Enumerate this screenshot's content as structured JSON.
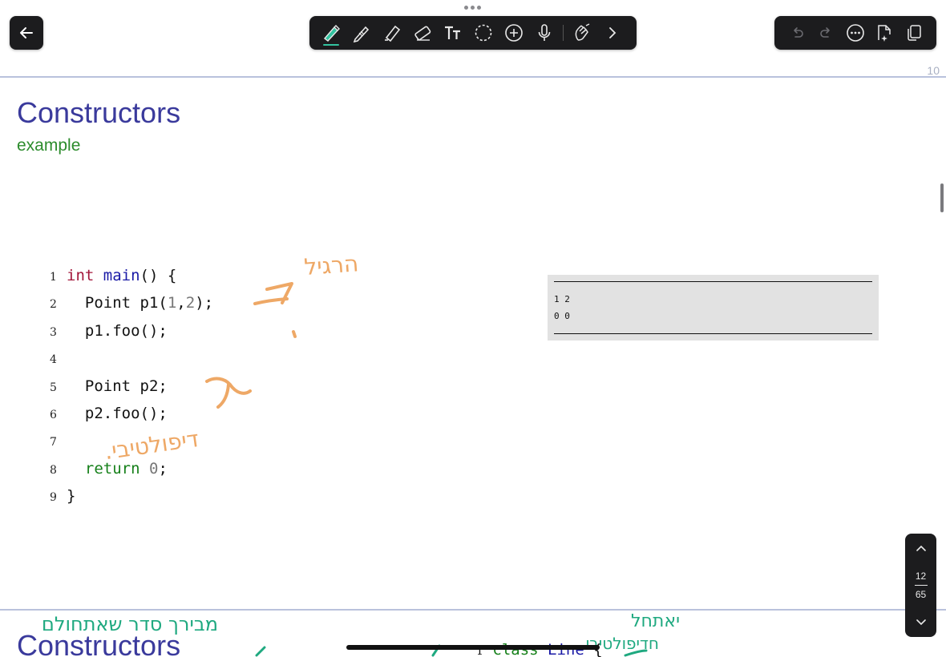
{
  "toolbar": {
    "tools": [
      {
        "name": "highlighter-pen",
        "active": true
      },
      {
        "name": "pen"
      },
      {
        "name": "highlighter"
      },
      {
        "name": "eraser"
      },
      {
        "name": "text"
      },
      {
        "name": "lasso"
      },
      {
        "name": "add"
      },
      {
        "name": "microphone"
      },
      {
        "name": "hand"
      },
      {
        "name": "more-chevron"
      }
    ],
    "actions": [
      "undo",
      "redo",
      "more",
      "export",
      "pages"
    ]
  },
  "pages": {
    "top_page_number": "10",
    "slide": {
      "title": "Constructors",
      "subtitle": "example",
      "code": [
        {
          "n": "1"
        },
        {
          "n": "2"
        },
        {
          "n": "3"
        },
        {
          "n": "4"
        },
        {
          "n": "5"
        },
        {
          "n": "6"
        },
        {
          "n": "7"
        },
        {
          "n": "8"
        },
        {
          "n": "9"
        }
      ],
      "code_text": {
        "l1": {
          "type": "int",
          "fn": "main",
          "rest": "() {"
        },
        "l2": {
          "a": "  Point p1(",
          "n1": "1",
          "c": ",",
          "n2": "2",
          "b": ");"
        },
        "l3": "  p1.foo();",
        "l5": "  Point p2;",
        "l6": "  p2.foo();",
        "l8": {
          "kw": "return",
          "sp": " ",
          "n": "0",
          "end": ";"
        },
        "l9": "}"
      },
      "output_lines": [
        "1 2",
        "0 0"
      ]
    },
    "next_slide": {
      "title": "Constructors",
      "code_peek": {
        "n": "1",
        "kw": "class",
        "name": "Line",
        "rest": " {"
      }
    }
  },
  "annotations": {
    "orange": [
      "הרגיל",
      "דיפולטיבי."
    ],
    "green": [
      "מבירך סדר שאתחולם",
      "יאתחל",
      "חדיפולטיבי"
    ]
  },
  "page_nav": {
    "current": "12",
    "total": "65"
  },
  "colors": {
    "title": "#3a3a9c",
    "subtitle": "#2c8c2c",
    "annotation_orange": "#eea866",
    "annotation_green": "#1fa980",
    "accent": "#33c3a0"
  }
}
